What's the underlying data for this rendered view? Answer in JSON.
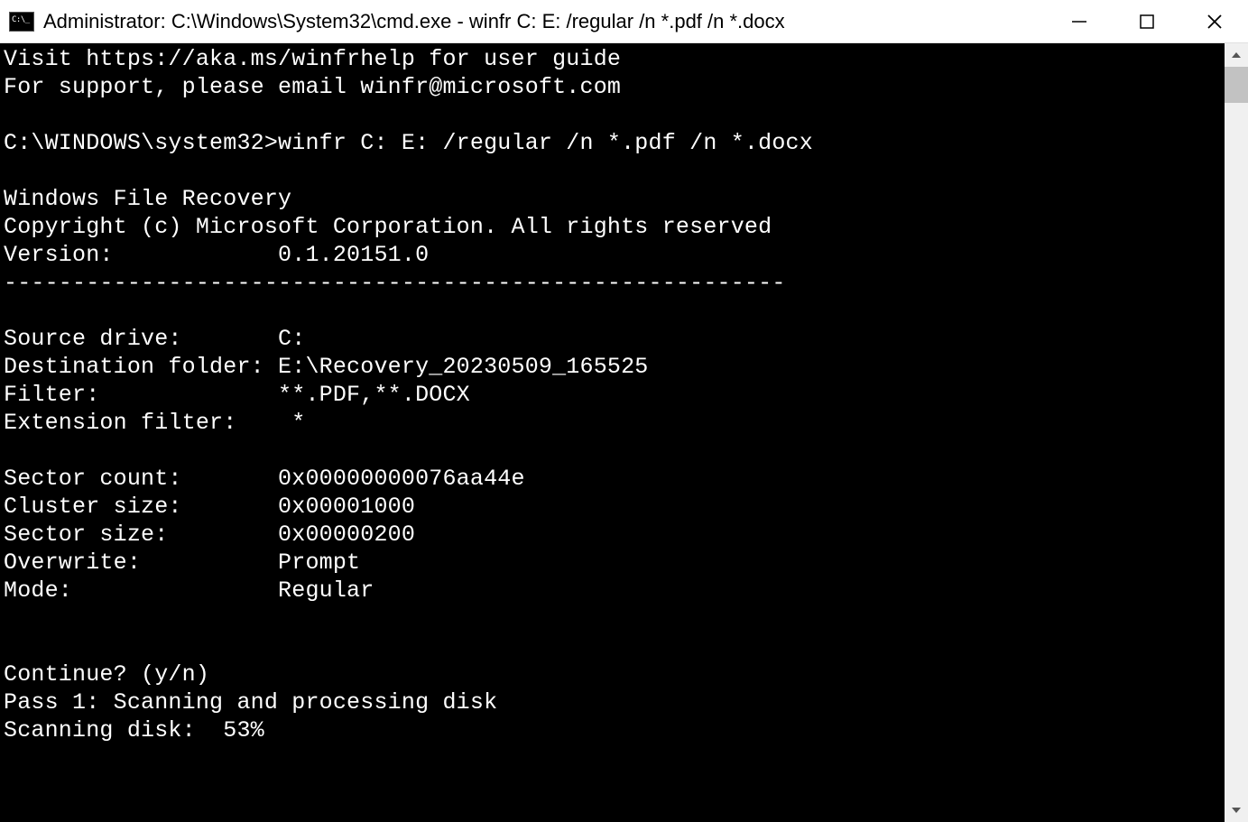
{
  "window": {
    "title": "Administrator: C:\\Windows\\System32\\cmd.exe - winfr  C: E: /regular /n *.pdf /n *.docx"
  },
  "terminal": {
    "lines": [
      "Visit https://aka.ms/winfrhelp for user guide",
      "For support, please email winfr@microsoft.com",
      "",
      "C:\\WINDOWS\\system32>winfr C: E: /regular /n *.pdf /n *.docx",
      "",
      "Windows File Recovery",
      "Copyright (c) Microsoft Corporation. All rights reserved",
      "Version:            0.1.20151.0",
      "---------------------------------------------------------",
      "",
      "Source drive:       C:",
      "Destination folder: E:\\Recovery_20230509_165525",
      "Filter:             **.PDF,**.DOCX",
      "Extension filter:    *",
      "",
      "Sector count:       0x00000000076aa44e",
      "Cluster size:       0x00001000",
      "Sector size:        0x00000200",
      "Overwrite:          Prompt",
      "Mode:               Regular",
      "",
      "",
      "Continue? (y/n)",
      "Pass 1: Scanning and processing disk",
      "Scanning disk:  53%"
    ]
  }
}
